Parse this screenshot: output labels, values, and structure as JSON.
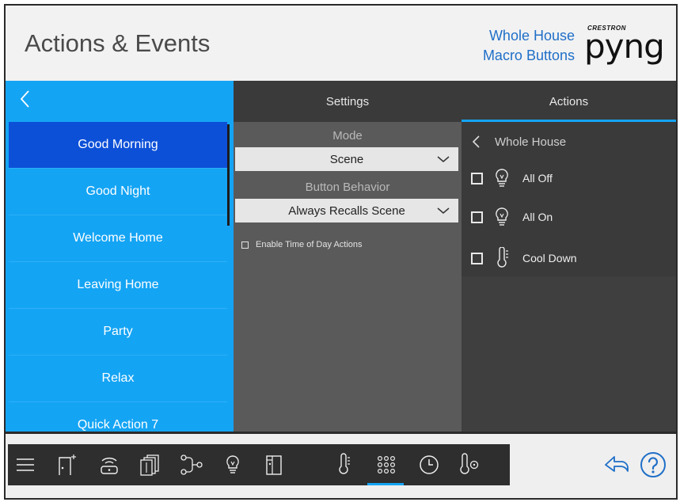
{
  "header": {
    "title": "Actions & Events",
    "subtitle_line1": "Whole House",
    "subtitle_line2": "Macro Buttons",
    "logo_small": "CRESTRON",
    "logo_big": "pyng"
  },
  "left_list": {
    "items": [
      {
        "label": "Good Morning",
        "selected": true
      },
      {
        "label": "Good Night"
      },
      {
        "label": "Welcome Home"
      },
      {
        "label": "Leaving Home"
      },
      {
        "label": "Party"
      },
      {
        "label": "Relax"
      },
      {
        "label": "Quick Action 7"
      }
    ]
  },
  "tabs": {
    "settings": "Settings",
    "actions": "Actions",
    "active": "actions"
  },
  "settings": {
    "mode_label": "Mode",
    "mode_value": "Scene",
    "behavior_label": "Button Behavior",
    "behavior_value": "Always Recalls Scene",
    "time_of_day_label": "Enable Time of Day Actions",
    "time_of_day_checked": false
  },
  "actions": {
    "breadcrumb": "Whole House",
    "rows": [
      {
        "label": "All Off",
        "icon": "bulb-icon",
        "checked": false
      },
      {
        "label": "All On",
        "icon": "bulb-icon",
        "checked": false
      },
      {
        "label": "Cool Down",
        "icon": "thermometer-icon",
        "checked": false
      }
    ]
  },
  "bottom_nav": {
    "items": [
      "menu-icon",
      "door-icon",
      "gateway-icon",
      "shades-icon",
      "flow-icon",
      "bulb-icon",
      "window-icon",
      "thermometer-icon",
      "keypad-icon",
      "clock-icon",
      "climate-icon"
    ],
    "active": "keypad-icon"
  },
  "colors": {
    "accent": "#14a4f4",
    "selected": "#0d50d8",
    "title_text": "#4a4a4a",
    "subtitle_text": "#1f6fc8"
  }
}
